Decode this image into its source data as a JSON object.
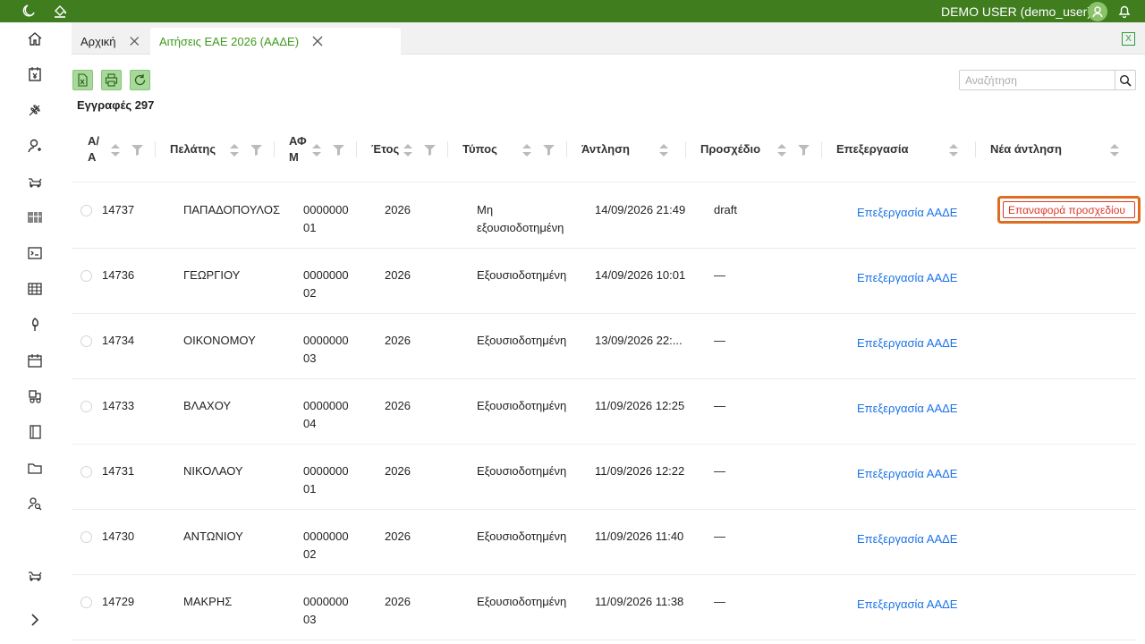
{
  "topbar": {
    "user_label": "DEMO USER (demo_user)",
    "icons": [
      "moon-icon",
      "paint-bucket-icon",
      "avatar-icon",
      "bell-icon"
    ],
    "color": "#3f7d1e"
  },
  "sidebar": {
    "items": [
      "home-icon",
      "invoice-icon",
      "wheat-icon",
      "user-icon",
      "tractor-icon",
      "barcode-icon",
      "terminal-icon",
      "table-icon",
      "tree-icon",
      "calendar-icon",
      "machinery-icon",
      "book-icon",
      "folder-icon",
      "user-search-icon",
      "cow-icon",
      "chevron-right-icon"
    ]
  },
  "tabs": [
    {
      "label": "Αρχική"
    },
    {
      "label": "Αιτήσεις ΕΑΕ 2026 (ΑΑΔΕ)"
    }
  ],
  "toolbar": {
    "records_label": "Εγγραφές 297",
    "search_placeholder": "Αναζήτηση"
  },
  "columns": {
    "aa_line1": "Α/",
    "aa_line2": "Α",
    "client": "Πελάτης",
    "afm_line1": "ΑΦ",
    "afm_line2": "Μ",
    "year": "Έτος",
    "type": "Τύπος",
    "pumping": "Άντληση",
    "draft": "Προσχέδιο",
    "processing": "Επεξεργασία",
    "new_pumping": "Νέα άντληση"
  },
  "rows": [
    {
      "aa": "14737",
      "client": "ΠΑΠΑΔΟΠΟΥΛΟΣ",
      "afm1": "0000000",
      "afm2": "01",
      "year": "2026",
      "type1": "Μη",
      "type2": "εξουσιοδοτημένη",
      "pumping": "14/09/2026 21:49",
      "draft": "draft",
      "processing": "Επεξεργασία ΑΑΔΕ",
      "action": "Επαναφορά προσχεδίου"
    },
    {
      "aa": "14736",
      "client": "ΓΕΩΡΓΙΟΥ",
      "afm1": "0000000",
      "afm2": "02",
      "year": "2026",
      "type1": "Εξουσιοδοτημένη",
      "type2": "",
      "pumping": "14/09/2026 10:01",
      "draft": "—",
      "processing": "Επεξεργασία ΑΑΔΕ",
      "action": ""
    },
    {
      "aa": "14734",
      "client": "ΟΙΚΟΝΟΜΟΥ",
      "afm1": "0000000",
      "afm2": "03",
      "year": "2026",
      "type1": "Εξουσιοδοτημένη",
      "type2": "",
      "pumping": "13/09/2026 22:...",
      "draft": "—",
      "processing": "Επεξεργασία ΑΑΔΕ",
      "action": ""
    },
    {
      "aa": "14733",
      "client": "ΒΛΑΧΟΥ",
      "afm1": "0000000",
      "afm2": "04",
      "year": "2026",
      "type1": "Εξουσιοδοτημένη",
      "type2": "",
      "pumping": "11/09/2026 12:25",
      "draft": "—",
      "processing": "Επεξεργασία ΑΑΔΕ",
      "action": ""
    },
    {
      "aa": "14731",
      "client": "ΝΙΚΟΛΑΟΥ",
      "afm1": "0000000",
      "afm2": "01",
      "year": "2026",
      "type1": "Εξουσιοδοτημένη",
      "type2": "",
      "pumping": "11/09/2026 12:22",
      "draft": "—",
      "processing": "Επεξεργασία ΑΑΔΕ",
      "action": ""
    },
    {
      "aa": "14730",
      "client": "ΑΝΤΩΝΙΟΥ",
      "afm1": "0000000",
      "afm2": "02",
      "year": "2026",
      "type1": "Εξουσιοδοτημένη",
      "type2": "",
      "pumping": "11/09/2026 11:40",
      "draft": "—",
      "processing": "Επεξεργασία ΑΑΔΕ",
      "action": ""
    },
    {
      "aa": "14729",
      "client": "ΜΑΚΡΗΣ",
      "afm1": "0000000",
      "afm2": "03",
      "year": "2026",
      "type1": "Εξουσιοδοτημένη",
      "type2": "",
      "pumping": "11/09/2026 11:38",
      "draft": "—",
      "processing": "Επεξεργασία ΑΑΔΕ",
      "action": ""
    }
  ]
}
